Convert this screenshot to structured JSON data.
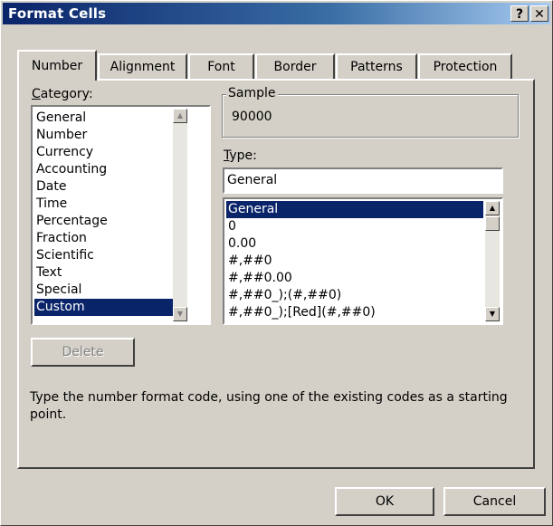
{
  "dialog": {
    "title": "Format Cells",
    "help_button": "?",
    "close_button": "✕"
  },
  "tabs": [
    {
      "label": "Number",
      "active": true
    },
    {
      "label": "Alignment",
      "active": false
    },
    {
      "label": "Font",
      "active": false
    },
    {
      "label": "Border",
      "active": false
    },
    {
      "label": "Patterns",
      "active": false
    },
    {
      "label": "Protection",
      "active": false
    }
  ],
  "category": {
    "label_accel": "C",
    "label_rest": "ategory:",
    "items": [
      "General",
      "Number",
      "Currency",
      "Accounting",
      "Date",
      "Time",
      "Percentage",
      "Fraction",
      "Scientific",
      "Text",
      "Special",
      "Custom"
    ],
    "selected": "Custom"
  },
  "sample": {
    "legend": "Sample",
    "value": "90000"
  },
  "type": {
    "label_accel": "T",
    "label_rest": "ype:",
    "input_value": "General",
    "items": [
      "General",
      "0",
      "0.00",
      "#,##0",
      "#,##0.00",
      "#,##0_);(#,##0)",
      "#,##0_);[Red](#,##0)"
    ],
    "selected": "General"
  },
  "delete_button": "Delete",
  "description": "Type the number format code, using one of the existing codes as a starting point.",
  "ok_button": "OK",
  "cancel_button": "Cancel",
  "colors": {
    "face": "#d4d0c8",
    "selection": "#0a246a",
    "title_start": "#0a246a",
    "title_end": "#a6caf0"
  }
}
